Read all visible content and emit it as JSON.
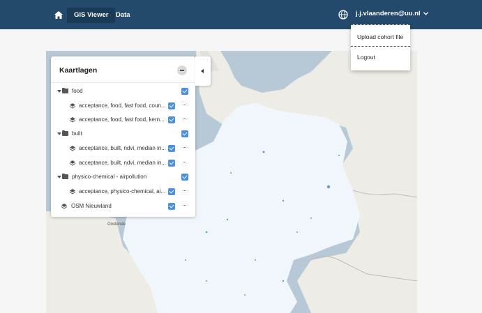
{
  "topbar": {
    "home_icon": "home-icon",
    "tabs": [
      {
        "label": "GIS Viewer",
        "active": true
      },
      {
        "label": "Data",
        "active": false
      }
    ],
    "globe_icon": "globe-icon",
    "user": "j.j.vlaanderen@uu.nl",
    "colors": {
      "bar": "#234a6c",
      "active_tab": "#1b3a56"
    }
  },
  "user_dropdown": {
    "items": [
      "Upload cohort file",
      "Logout"
    ]
  },
  "map": {
    "place_labels": [
      "Oostende"
    ],
    "colors": {
      "water": "#b7c8d6",
      "land": "#eeece6",
      "overlay": "#f1f6fc",
      "points": "#5b9fd8"
    }
  },
  "layers_panel": {
    "title": "Kaartlagen",
    "items": [
      {
        "kind": "group",
        "label": "food",
        "checked": true
      },
      {
        "kind": "layer",
        "label": "acceptance, food, fast food, coun...",
        "checked": true
      },
      {
        "kind": "layer",
        "label": "acceptance, food, fast food, kern...",
        "checked": true
      },
      {
        "kind": "group",
        "label": "built",
        "checked": true
      },
      {
        "kind": "layer",
        "label": "acceptance, built, ndvi, median in...",
        "checked": true
      },
      {
        "kind": "layer",
        "label": "acceptance, built, ndvi, median in...",
        "checked": true
      },
      {
        "kind": "group",
        "label": "physico-chemical - airpollution",
        "checked": true
      },
      {
        "kind": "layer",
        "label": "acceptance, physico-chemical, ai...",
        "checked": true
      },
      {
        "kind": "layer-root",
        "label": "OSM Nieuwland",
        "checked": true
      }
    ],
    "more_label": "···"
  }
}
